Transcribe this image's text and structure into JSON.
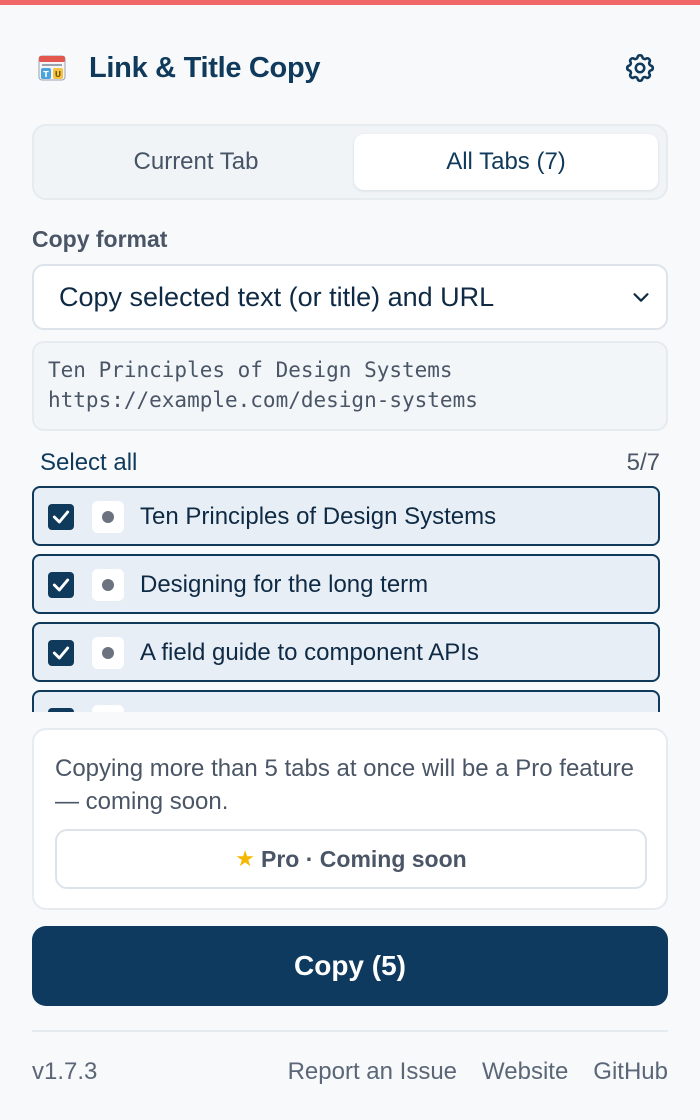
{
  "header": {
    "title": "Link & Title Copy",
    "logo_icon": "clipboard-app-icon",
    "settings_icon": "gear-icon"
  },
  "tabs": [
    {
      "label": "Current Tab",
      "active": false
    },
    {
      "label": "All Tabs (7)",
      "active": true
    }
  ],
  "format": {
    "label": "Copy format",
    "selected": "Copy selected text (or title) and URL"
  },
  "preview": {
    "line1": "Ten Principles of Design Systems",
    "line2": "https://example.com/design-systems"
  },
  "selection": {
    "select_all_label": "Select all",
    "count": "5/7"
  },
  "tab_items": [
    {
      "title": "Ten Principles of Design Systems",
      "checked": true
    },
    {
      "title": "Designing for the long term",
      "checked": true
    },
    {
      "title": "A field guide to component APIs",
      "checked": true
    },
    {
      "title": "",
      "checked": true
    }
  ],
  "pro": {
    "message": "Copying more than 5 tabs at once will be a Pro feature — coming soon.",
    "button_label": "Pro · Coming soon",
    "button_icon": "star-icon"
  },
  "copy_button": {
    "label": "Copy (5)"
  },
  "footer": {
    "version": "v1.7.3",
    "links": [
      "Report an Issue",
      "Website",
      "GitHub"
    ]
  },
  "colors": {
    "accent": "#0d3a5e",
    "top_stripe": "#f16667",
    "row_bg": "#e7eef5"
  }
}
